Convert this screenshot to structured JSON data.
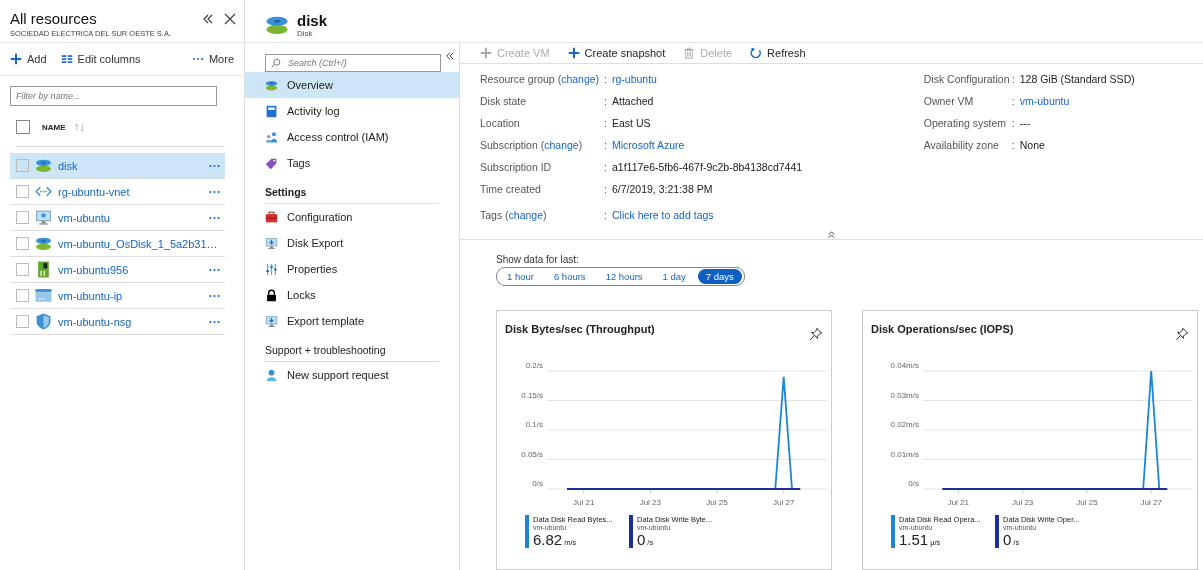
{
  "resources_panel": {
    "title": "All resources",
    "subtitle": "SOCIEDAD ELECTRICA DEL SUR OESTE S.A.",
    "toolbar": [
      {
        "kind": "add",
        "label": "Add"
      },
      {
        "kind": "columns",
        "label": "Edit columns"
      },
      {
        "kind": "more",
        "label": "More"
      }
    ],
    "filter": {
      "placeholder": "Filter by name..."
    },
    "select_all": {
      "checked": false
    },
    "column": "NAME",
    "rows": [
      {
        "kind": "disk",
        "name": "disk",
        "selected": true,
        "checked": false
      },
      {
        "kind": "vnet",
        "name": "rg-ubuntu-vnet",
        "selected": false,
        "checked": false
      },
      {
        "kind": "vm",
        "name": "vm-ubuntu",
        "selected": false,
        "checked": false
      },
      {
        "kind": "disk",
        "name": "vm-ubuntu_OsDisk_1_5a2b31…",
        "selected": false,
        "checked": false
      },
      {
        "kind": "nic",
        "name": "vm-ubuntu956",
        "selected": false,
        "checked": false
      },
      {
        "kind": "ip",
        "name": "vm-ubuntu-ip",
        "selected": false,
        "checked": false
      },
      {
        "kind": "nsg",
        "name": "vm-ubuntu-nsg",
        "selected": false,
        "checked": false
      }
    ]
  },
  "blade": {
    "title": "disk",
    "subtitle": "Disk"
  },
  "menu": {
    "search": {
      "placeholder": "Search (Ctrl+/)"
    },
    "groups": [
      {
        "items": [
          {
            "kind": "overview",
            "label": "Overview",
            "selected": true
          },
          {
            "kind": "activity",
            "label": "Activity log",
            "selected": false
          },
          {
            "kind": "iam",
            "label": "Access control (IAM)",
            "selected": false
          },
          {
            "kind": "tags",
            "label": "Tags",
            "selected": false
          }
        ]
      },
      {
        "title": "Settings",
        "items": [
          {
            "kind": "configuration",
            "label": "Configuration",
            "selected": false
          },
          {
            "kind": "export",
            "label": "Disk Export",
            "selected": false
          },
          {
            "kind": "properties",
            "label": "Properties",
            "selected": false
          },
          {
            "kind": "locks",
            "label": "Locks",
            "selected": false
          },
          {
            "kind": "template",
            "label": "Export template",
            "selected": false
          }
        ]
      },
      {
        "title": "Support + troubleshooting",
        "items": [
          {
            "kind": "support",
            "label": "New support request",
            "selected": false
          }
        ]
      }
    ]
  },
  "toolbar": [
    {
      "kind": "add",
      "label": "Create VM",
      "disabled": true
    },
    {
      "kind": "add",
      "label": "Create snapshot",
      "disabled": false
    },
    {
      "kind": "delete",
      "label": "Delete",
      "disabled": true
    },
    {
      "kind": "refresh",
      "label": "Refresh",
      "disabled": false
    }
  ],
  "essentials": {
    "left": [
      {
        "label": "Resource group (",
        "change": "change",
        "label_end": ")",
        "separator": ":",
        "value": "rg-ubuntu",
        "link": true
      },
      {
        "label": "Disk state",
        "separator": ":",
        "value": "Attached",
        "link": false
      },
      {
        "label": "Location",
        "separator": ":",
        "value": "East US",
        "link": false
      },
      {
        "label": "Subscription (",
        "change": "change",
        "label_end": ")",
        "separator": ":",
        "value": "Microsoft Azure",
        "link": true
      },
      {
        "label": "Subscription ID",
        "separator": ":",
        "value": "a1f117e6-5fb6-467f-9c2b-8b4138cd7441",
        "link": false
      },
      {
        "label": "Time created",
        "separator": ":",
        "value": "6/7/2019, 3:21:38 PM",
        "link": false
      },
      {
        "label": "Tags (",
        "change": "change",
        "label_end": ")",
        "separator": ":",
        "value": "Click here to add tags",
        "link": true
      }
    ],
    "right": [
      {
        "label": "Disk Configuration",
        "separator": ":",
        "value": "128 GiB (Standard SSD)",
        "link": false
      },
      {
        "label": "Owner VM",
        "separator": ":",
        "value": "vm-ubuntu",
        "link": true
      },
      {
        "label": "Operating system",
        "separator": ":",
        "value": "---",
        "link": false
      },
      {
        "label": "Availability zone",
        "separator": ":",
        "value": "None",
        "link": false
      }
    ]
  },
  "time_range": {
    "label": "Show data for last:",
    "options": [
      {
        "label": "1 hour",
        "selected": false
      },
      {
        "label": "6 hours",
        "selected": false
      },
      {
        "label": "12 hours",
        "selected": false
      },
      {
        "label": "1 day",
        "selected": false
      },
      {
        "label": "7 days",
        "selected": true
      }
    ]
  },
  "charts": [
    {
      "title": "Disk Bytes/sec (Throughput)",
      "chart_data": {
        "type": "line",
        "grid": true,
        "ylim": [
          0,
          0.2
        ],
        "categories": [
          null,
          null,
          "Jul 21",
          null,
          null,
          null,
          null,
          null,
          null,
          null,
          "Jul 23",
          null,
          null,
          null,
          null,
          null,
          null,
          null,
          "Jul 25",
          null,
          null,
          null,
          null,
          null,
          null,
          null,
          "Jul 27",
          null,
          null
        ],
        "yticks": [
          {
            "value": 0,
            "label": "0/s"
          },
          {
            "value": 0.05,
            "label": "0.05/s"
          },
          {
            "value": 0.1,
            "label": "0.1/s"
          },
          {
            "value": 0.15,
            "label": "0.15/s"
          },
          {
            "value": 0.2,
            "label": "0.2/s"
          }
        ],
        "series": [
          {
            "name": "Data Disk Read Bytes...",
            "color": "#1a86d8",
            "values": [
              null,
              null,
              null,
              null,
              null,
              null,
              null,
              null,
              null,
              null,
              null,
              null,
              null,
              null,
              null,
              null,
              null,
              null,
              null,
              null,
              null,
              null,
              null,
              null,
              null,
              0,
              0.19,
              0,
              null
            ]
          },
          {
            "name": "Data Disk Write Byte...",
            "color": "#1b2f9c",
            "values": [
              0,
              0,
              0,
              0,
              0,
              0,
              0,
              0,
              0,
              0,
              0,
              0,
              0,
              0,
              0,
              0,
              0,
              0,
              0,
              0,
              0,
              0,
              0,
              0,
              0,
              0,
              0,
              0,
              0
            ]
          }
        ]
      },
      "legend": [
        {
          "resource": "vm-ubuntu",
          "value": "6.82",
          "unit": "m/s"
        },
        {
          "resource": "vm-ubuntu",
          "value": "0",
          "unit": "/s"
        }
      ]
    },
    {
      "title": "Disk Operations/sec (IOPS)",
      "chart_data": {
        "type": "line",
        "grid": true,
        "ylim": [
          0,
          0.04
        ],
        "categories": [
          null,
          null,
          "Jul 21",
          null,
          null,
          null,
          null,
          null,
          null,
          null,
          "Jul 23",
          null,
          null,
          null,
          null,
          null,
          null,
          null,
          "Jul 25",
          null,
          null,
          null,
          null,
          null,
          null,
          null,
          "Jul 27",
          null,
          null
        ],
        "yticks": [
          {
            "value": 0,
            "label": "0/s"
          },
          {
            "value": 0.01,
            "label": "0.01m/s"
          },
          {
            "value": 0.02,
            "label": "0.02m/s"
          },
          {
            "value": 0.03,
            "label": "0.03m/s"
          },
          {
            "value": 0.04,
            "label": "0.04m/s"
          }
        ],
        "series": [
          {
            "name": "Data Disk Read Opera...",
            "color": "#1a86d8",
            "values": [
              null,
              null,
              null,
              null,
              null,
              null,
              null,
              null,
              null,
              null,
              null,
              null,
              null,
              null,
              null,
              null,
              null,
              null,
              null,
              null,
              null,
              null,
              null,
              null,
              null,
              0,
              0.04,
              0,
              null
            ]
          },
          {
            "name": "Data Disk Write Oper...",
            "color": "#1b2f9c",
            "values": [
              0,
              0,
              0,
              0,
              0,
              0,
              0,
              0,
              0,
              0,
              0,
              0,
              0,
              0,
              0,
              0,
              0,
              0,
              0,
              0,
              0,
              0,
              0,
              0,
              0,
              0,
              0,
              0,
              0
            ]
          }
        ]
      },
      "legend": [
        {
          "resource": "vm-ubuntu",
          "value": "1.51",
          "unit": "µ/s"
        },
        {
          "resource": "vm-ubuntu",
          "value": "0",
          "unit": "/s"
        }
      ]
    }
  ]
}
